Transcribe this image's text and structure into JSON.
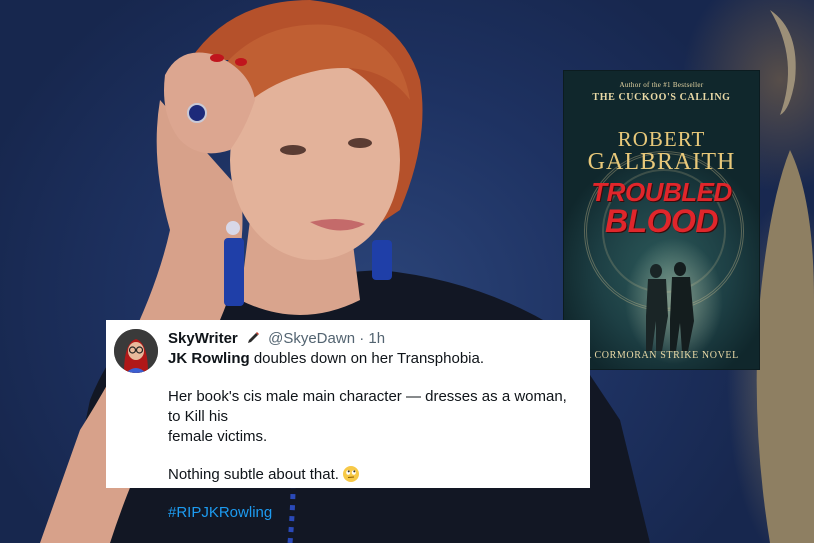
{
  "tweet": {
    "display_name": "SkyWriter",
    "handle": "@SkyeDawn",
    "separator": "·",
    "time": "1h",
    "lines": [
      {
        "strong": "JK Rowling",
        "rest": " doubles down on her Transphobia."
      },
      {
        "strong": "",
        "rest": "Her book's cis male main character — dresses as a woman, to Kill his"
      },
      {
        "strong": "",
        "rest": "female victims."
      },
      {
        "strong": "",
        "rest": "Nothing subtle about that."
      }
    ],
    "hashtag": "#RIPJKRowling",
    "icons": {
      "pen": "pen-icon",
      "emoji": "eye-roll-emoji-icon"
    }
  },
  "book": {
    "top_line": "Author of the #1 Bestseller",
    "top_title": "THE CUCKOO'S CALLING",
    "author_first": "ROBERT",
    "author_last": "GALBRAITH",
    "title_line1": "TROUBLED",
    "title_line2": "BLOOD",
    "series": "A CORMORAN STRIKE NOVEL"
  },
  "colors": {
    "background": "#1f2f5a",
    "hashtag": "#1d9bf0",
    "title_red": "#e0262b",
    "book_gold": "#e8c87a"
  }
}
